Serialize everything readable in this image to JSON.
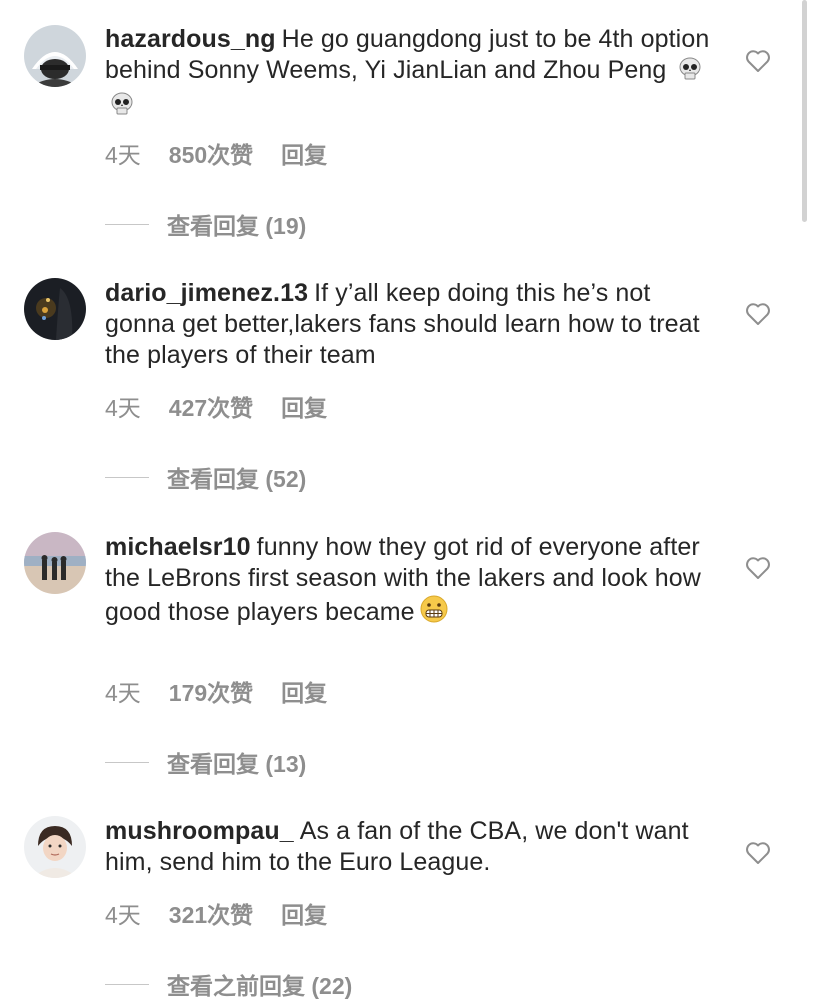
{
  "comments": [
    {
      "username": "hazardous_ng",
      "text": "He go guangdong just to be 4th option behind Sonny Weems, Yi JianLian and Zhou Peng",
      "emoji": "skull-emoji skull-emoji",
      "time": "4天",
      "likes": "850次赞",
      "reply": "回复",
      "view_replies": "查看回复 (19)"
    },
    {
      "username": "dario_jimenez.13",
      "text": "If y’all keep doing this he’s not gonna get better,lakers fans should learn how to treat the players of their team",
      "time": "4天",
      "likes": "427次赞",
      "reply": "回复",
      "view_replies": "查看回复 (52)"
    },
    {
      "username": "michaelsr10",
      "text": "funny how they got rid of everyone after the LeBrons first season with the lakers and look how good those players became",
      "emoji": "grimacing-face-emoji",
      "time": "4天",
      "likes": "179次赞",
      "reply": "回复",
      "view_replies": "查看回复 (13)"
    },
    {
      "username": "mushroompau_",
      "text": "As a fan of the CBA, we don't want him, send him to the Euro League.",
      "time": "4天",
      "likes": "321次赞",
      "reply": "回复",
      "view_replies": "查看之前回复 (22)"
    }
  ],
  "colors": {
    "text": "#262626",
    "secondary": "#8e8e8e",
    "background": "#ffffff"
  },
  "icons": {
    "like": "heart-outline-icon"
  }
}
